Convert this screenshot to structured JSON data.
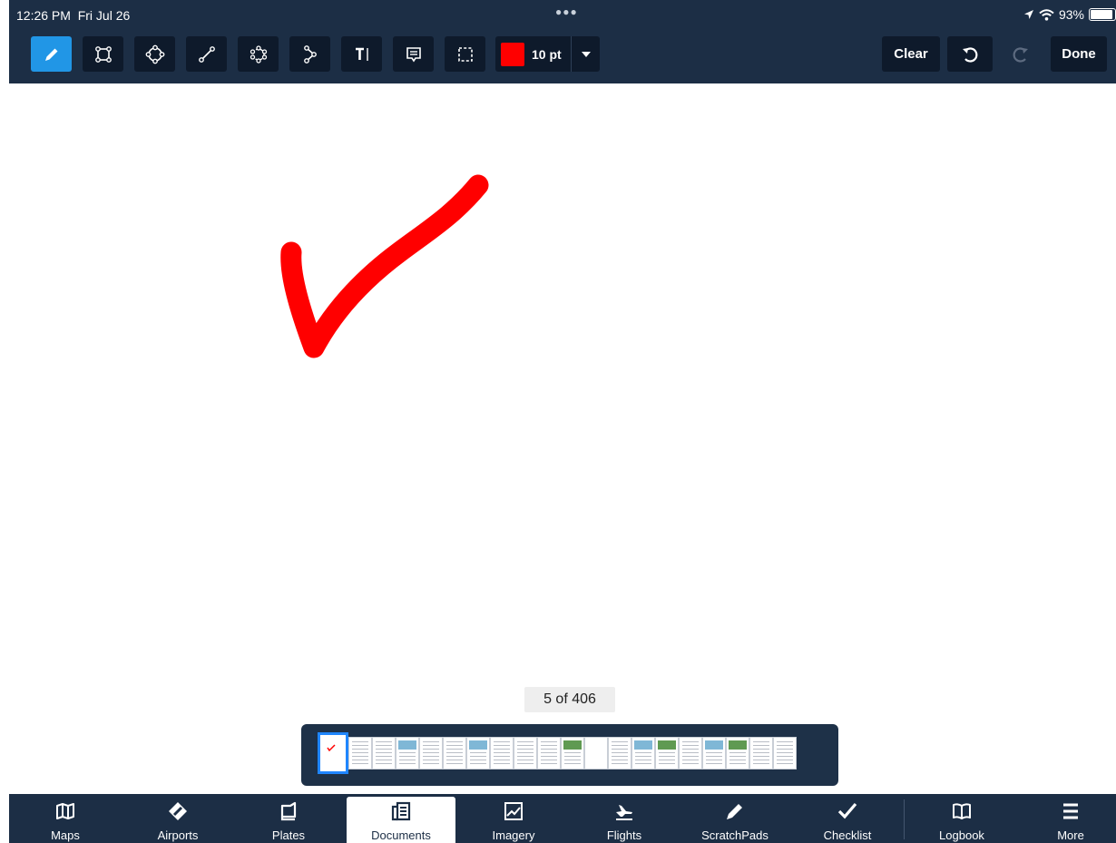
{
  "status": {
    "time": "12:26 PM",
    "date": "Fri Jul 26",
    "battery": "93%",
    "battery_level": 0.93
  },
  "toolbar": {
    "tools": [
      {
        "name": "pen-tool",
        "icon": "pencil-icon",
        "active": true
      },
      {
        "name": "rectangle-tool",
        "icon": "rectangle-icon"
      },
      {
        "name": "ellipse-tool",
        "icon": "ellipse-icon"
      },
      {
        "name": "line-tool",
        "icon": "line-icon"
      },
      {
        "name": "cloud-tool",
        "icon": "cloud-icon"
      },
      {
        "name": "polyline-tool",
        "icon": "polyline-icon"
      },
      {
        "name": "text-tool",
        "icon": "text-icon"
      },
      {
        "name": "note-tool",
        "icon": "note-icon"
      },
      {
        "name": "select-tool",
        "icon": "selection-icon"
      }
    ],
    "color": "#ff0000",
    "size_label": "10 pt",
    "clear_label": "Clear",
    "done_label": "Done"
  },
  "document": {
    "page_label": "5 of 406",
    "page": 5,
    "total": 406,
    "annotation_color": "#ff0000"
  },
  "thumbnails": [
    "current",
    "text",
    "text",
    "figure",
    "text",
    "text",
    "figure",
    "text",
    "text",
    "text",
    "photo",
    "blank",
    "text",
    "figure",
    "photo",
    "text",
    "figure",
    "photo",
    "text",
    "text"
  ],
  "tabs": [
    {
      "label": "Maps",
      "icon": "map-icon"
    },
    {
      "label": "Airports",
      "icon": "airport-icon"
    },
    {
      "label": "Plates",
      "icon": "plates-icon"
    },
    {
      "label": "Documents",
      "icon": "documents-icon",
      "active": true
    },
    {
      "label": "Imagery",
      "icon": "imagery-icon"
    },
    {
      "label": "Flights",
      "icon": "flights-icon"
    },
    {
      "label": "ScratchPads",
      "icon": "scratchpad-icon"
    },
    {
      "label": "Checklist",
      "icon": "checklist-icon"
    },
    {
      "label": "Logbook",
      "icon": "logbook-icon"
    },
    {
      "label": "More",
      "icon": "more-icon"
    }
  ],
  "colors": {
    "bar": "#1c2e45",
    "button": "#0e1a2b",
    "accent": "#2196e6"
  }
}
